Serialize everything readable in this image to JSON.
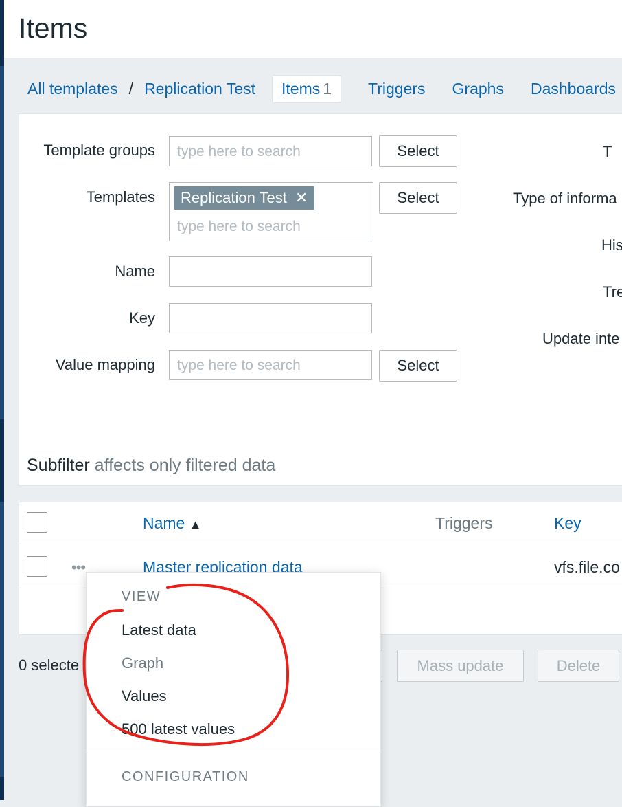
{
  "page": {
    "title": "Items"
  },
  "breadcrumb": {
    "all_templates": "All templates",
    "separator": "/",
    "template": "Replication Test"
  },
  "tabs": {
    "items": {
      "label": "Items",
      "count": "1"
    },
    "triggers": "Triggers",
    "graphs": "Graphs",
    "dashboards": "Dashboards"
  },
  "filter": {
    "template_groups": {
      "label": "Template groups",
      "placeholder": "type here to search",
      "button": "Select"
    },
    "templates": {
      "label": "Templates",
      "chip": "Replication Test",
      "placeholder": "type here to search",
      "button": "Select"
    },
    "name": {
      "label": "Name",
      "value": ""
    },
    "key": {
      "label": "Key",
      "value": ""
    },
    "value_mapping": {
      "label": "Value mapping",
      "placeholder": "type here to search",
      "button": "Select"
    },
    "right_labels": [
      "T",
      "Type of informa",
      "His",
      "Tre",
      "Update inte"
    ]
  },
  "subfilter": {
    "title": "Subfilter",
    "note": "affects only filtered data"
  },
  "table": {
    "headers": {
      "name": "Name",
      "sort_arrow": "▲",
      "triggers": "Triggers",
      "key": "Key"
    },
    "rows": [
      {
        "actions": "•••",
        "name": "Master replication data",
        "key": "vfs.file.co"
      }
    ]
  },
  "footer": {
    "selected": "0 selecte",
    "buttons": {
      "mass_update": "Mass update",
      "delete": "Delete"
    }
  },
  "context_menu": {
    "view_header": "VIEW",
    "items": [
      "Latest data",
      "Graph",
      "Values",
      "500 latest values"
    ],
    "config_header": "CONFIGURATION"
  },
  "colors": {
    "link": "#0a66b0",
    "annotation": "#e8211a",
    "chip": "#768d99",
    "nav": "#1f4a78"
  },
  "icons": {
    "remove_chip": "close-icon",
    "sort": "sort-asc-icon",
    "actions": "more-horizontal-icon"
  }
}
